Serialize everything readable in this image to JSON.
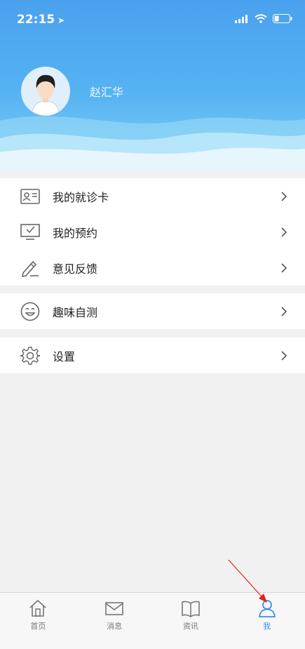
{
  "status_bar": {
    "time": "22:15",
    "location_arrow": "➤"
  },
  "profile": {
    "name": "赵汇华"
  },
  "menu_group_1": [
    {
      "label": "我的就诊卡",
      "icon": "id-card-icon"
    },
    {
      "label": "我的预约",
      "icon": "appointment-icon"
    },
    {
      "label": "意见反馈",
      "icon": "feedback-pencil-icon"
    }
  ],
  "menu_group_2": [
    {
      "label": "趣味自测",
      "icon": "smile-icon"
    }
  ],
  "menu_group_3": [
    {
      "label": "设置",
      "icon": "gear-icon"
    }
  ],
  "tabbar": {
    "items": [
      {
        "label": "首页",
        "icon": "home-icon"
      },
      {
        "label": "消息",
        "icon": "mail-icon"
      },
      {
        "label": "资讯",
        "icon": "book-icon"
      },
      {
        "label": "我",
        "icon": "person-icon"
      }
    ],
    "active_index": 3
  },
  "colors": {
    "accent": "#3a8ee6",
    "header_top": "#4aa1ee",
    "annotation": "#e02020"
  }
}
